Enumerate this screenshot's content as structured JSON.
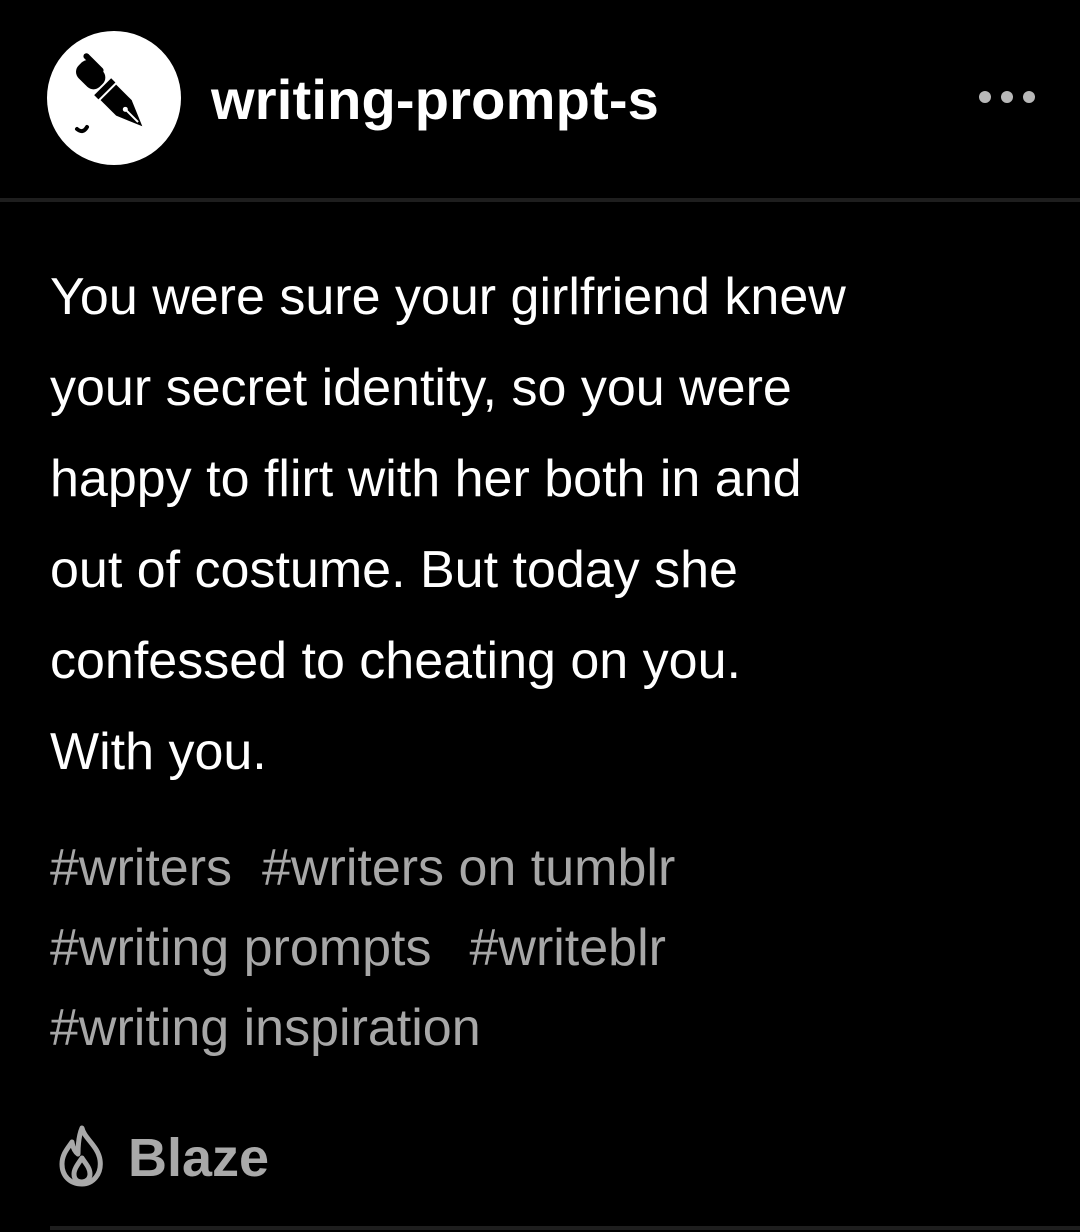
{
  "header": {
    "blog_name": "writing-prompt-s",
    "avatar_icon": "pen-icon",
    "more_icon": "more-dots-icon"
  },
  "post": {
    "lines": [
      "You were sure your girlfriend knew",
      "your secret identity, so you were",
      "happy to flirt with her both in and",
      "out of costume. But today she",
      "confessed to cheating on you.",
      "With you."
    ]
  },
  "tags": {
    "rows": [
      [
        "#writers",
        "#writers on tumblr"
      ],
      [
        "#writing prompts",
        "#writeblr"
      ],
      [
        "#writing inspiration"
      ]
    ]
  },
  "footer": {
    "blaze_label": "Blaze",
    "blaze_icon": "flame-icon"
  },
  "colors": {
    "background": "#000000",
    "text": "#ffffff",
    "tag_text": "#a7a7a7",
    "muted": "#a9a9a9",
    "divider": "#1e1e1e"
  }
}
